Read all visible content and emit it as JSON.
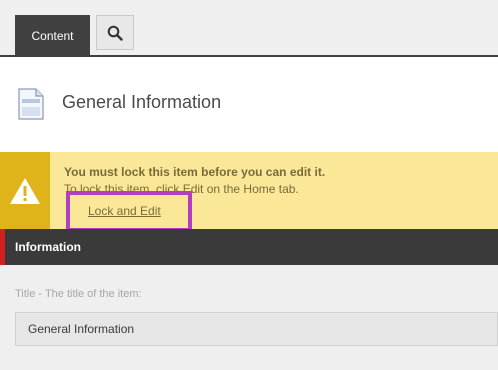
{
  "tabs": {
    "content_label": "Content",
    "search_icon": "search-icon"
  },
  "header": {
    "icon": "document-icon",
    "title": "General Information"
  },
  "warning": {
    "icon": "warning-icon",
    "line1": "You must lock this item before you can edit it.",
    "line2": "To lock this item, click Edit on the Home tab.",
    "link_label": "Lock and Edit",
    "colors": {
      "background": "#fae898",
      "side": "#dfb31a",
      "highlight_border": "#b23ec1"
    }
  },
  "section": {
    "title": "Information",
    "accent_color": "#d31f1f"
  },
  "field": {
    "label": "Title - The title of the item:",
    "value": "General Information"
  }
}
